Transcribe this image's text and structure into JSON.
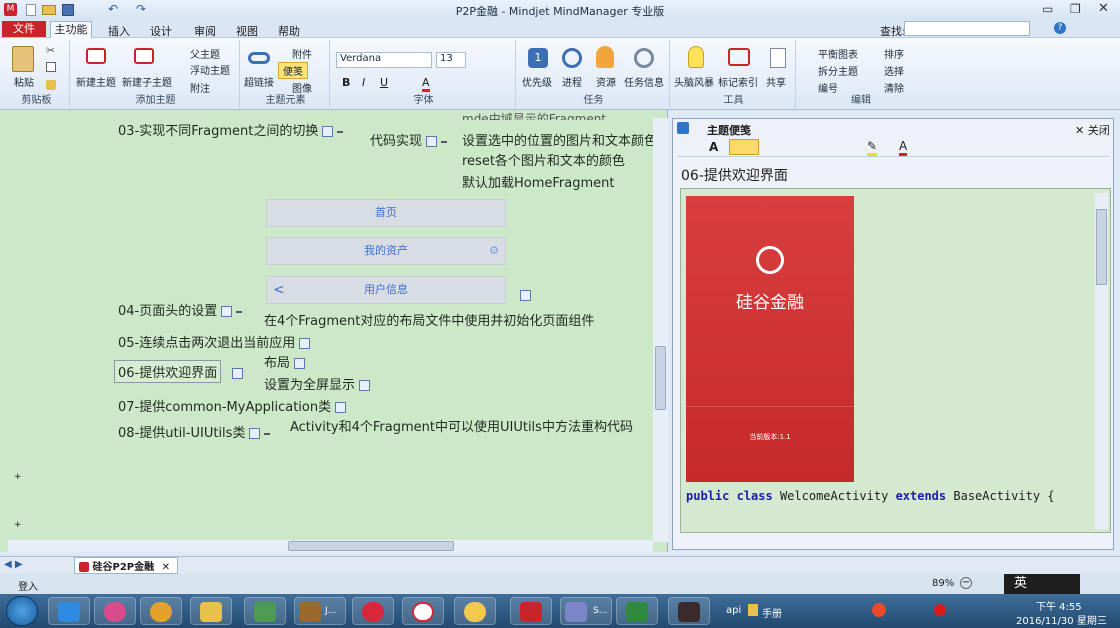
{
  "window": {
    "title": "P2P金融 - Mindjet MindManager 专业版"
  },
  "menu": {
    "items": [
      "文件",
      "主功能",
      "插入",
      "设计",
      "审阅",
      "视图",
      "帮助"
    ],
    "active": "主功能",
    "find_label": "查找:"
  },
  "ribbon": {
    "paste": "粘贴",
    "clipboard": "剪贴板",
    "new_topic": "新建主题",
    "new_subtopic": "新建子主题",
    "parent_topic": "父主题",
    "floating_topic": "浮动主题",
    "callout": "附注",
    "add_topic": "添加主题",
    "hyperlink": "超链接",
    "attachment": "附件",
    "notes": "便笺",
    "image": "图像",
    "topic_elements": "主题元素",
    "font_name": "Verdana",
    "font_size": "13",
    "font_group": "字体",
    "priority": "优先级",
    "progress": "进程",
    "resource": "资源",
    "task_info": "任务信息",
    "task_group": "任务",
    "brainstorm": "头脑风暴",
    "index": "标记索引",
    "share": "共享",
    "tools": "工具",
    "balance_map": "平衡图表",
    "split_topic": "拆分主题",
    "numbering": "编号",
    "sort": "排序",
    "select": "选择",
    "clear": "清除",
    "edit": "编辑"
  },
  "map": {
    "top_lines": [
      "mde中域显示的Fragment",
      "设置选中的位置的图片和文本颜色",
      "reset各个图片和文本的颜色",
      "默认加载HomeFragment"
    ],
    "topic03": "03-实现不同Fragment之间的切换",
    "code_impl": "代码实现",
    "bar_home": "首页",
    "bar_assets": "我的资产",
    "bar_user": "用户信息",
    "back_arrow": "<",
    "topic04": "04-页面头的设置",
    "topic04_child": "在4个Fragment对应的布局文件中使用并初始化页面组件",
    "topic05": "05-连续点击两次退出当前应用",
    "topic06": "06-提供欢迎界面",
    "topic06_child1": "布局",
    "topic06_child2": "设置为全屏显示",
    "topic07": "07-提供common-MyApplication类",
    "topic08": "08-提供util-UIUtils类",
    "topic08_child": "Activity和4个Fragment中可以使用UIUtils中方法重构代码"
  },
  "notes": {
    "pane_title": "主题便笺",
    "close": "关闭",
    "heading": "06-提供欢迎界面",
    "splash_title": "硅谷金融",
    "splash_version": "当前版本:1.1",
    "code_kw1": "public",
    "code_kw2": "class",
    "code_name": "WelcomeActivity",
    "code_kw3": "extends",
    "code_rest": "BaseActivity {"
  },
  "tabs": {
    "doc_tab": "硅谷P2P金融"
  },
  "status": {
    "login": "登入",
    "zoom": "89%",
    "ime": "英"
  },
  "taskbar": {
    "api_label": "api",
    "manual_label": "手册",
    "time": "下午 4:55",
    "date": "2016/11/30 星期三",
    "app_j": "J...",
    "app_s": "S..."
  },
  "colors": {
    "accent": "#c9242b",
    "notes_bg": "#d4e9cf",
    "map_bg": "#cde8c8"
  }
}
